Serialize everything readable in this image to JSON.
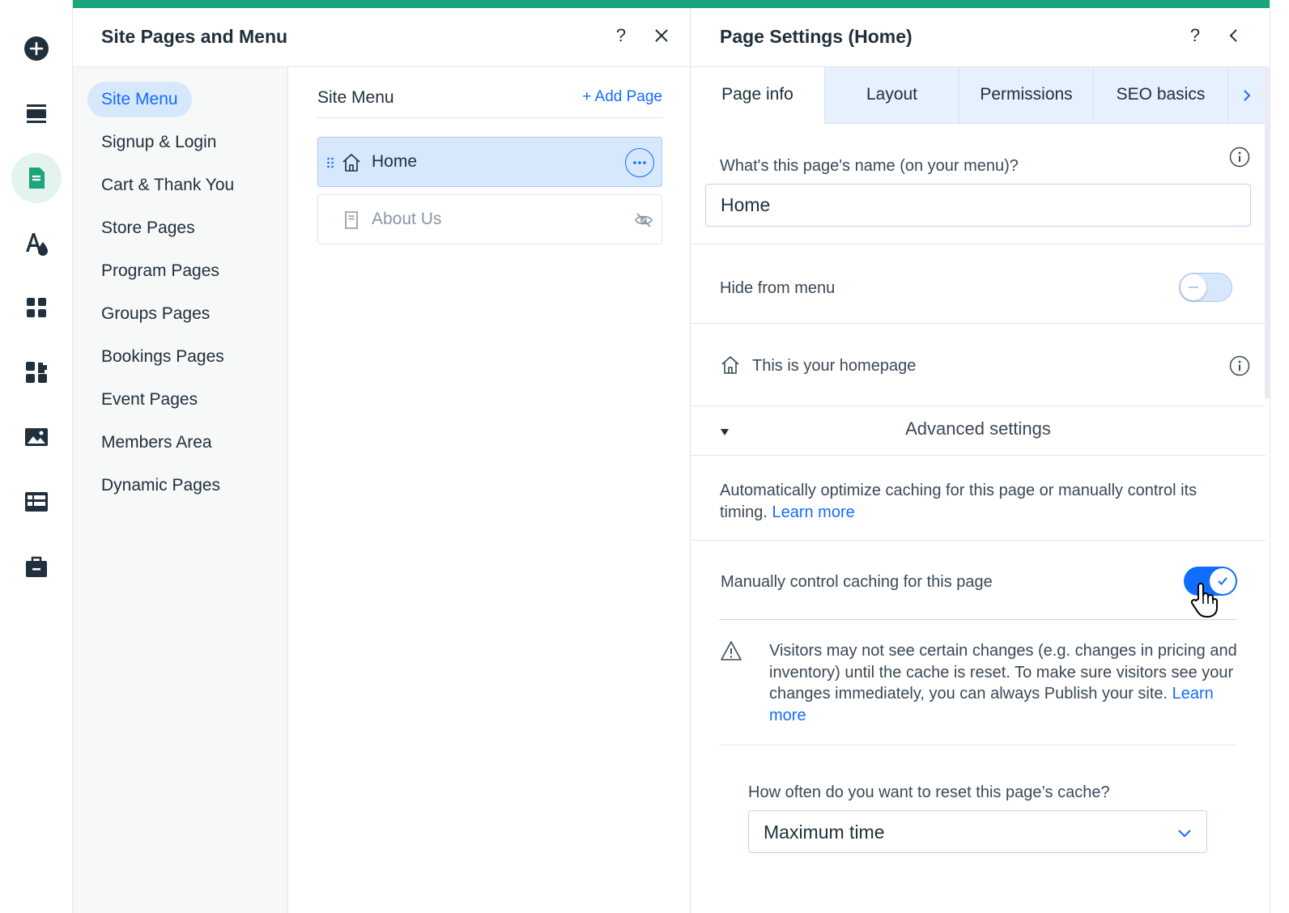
{
  "colors": {
    "accent": "#116dff",
    "brand_green": "#1ba57c",
    "selected_bg": "#d7e8fd"
  },
  "rail": {
    "items": [
      {
        "icon": "plus-circle-icon"
      },
      {
        "icon": "sections-icon"
      },
      {
        "icon": "pages-icon",
        "active": true
      },
      {
        "icon": "design-icon"
      },
      {
        "icon": "apps-icon"
      },
      {
        "icon": "business-apps-icon"
      },
      {
        "icon": "media-icon"
      },
      {
        "icon": "cms-table-icon"
      },
      {
        "icon": "portfolio-icon"
      }
    ]
  },
  "pages_panel": {
    "title": "Site Pages and Menu",
    "help_label": "?",
    "categories": [
      "Site Menu",
      "Signup & Login",
      "Cart & Thank You",
      "Store Pages",
      "Program Pages",
      "Groups Pages",
      "Bookings Pages",
      "Event Pages",
      "Members Area",
      "Dynamic Pages"
    ],
    "menu": {
      "title": "Site Menu",
      "add_page": "+ Add Page",
      "pages": [
        {
          "label": "Home",
          "icon": "home-icon",
          "selected": true
        },
        {
          "label": "About Us",
          "icon": "page-icon",
          "hidden": true
        }
      ]
    }
  },
  "settings": {
    "title": "Page Settings (Home)",
    "help_label": "?",
    "tabs": [
      "Page info",
      "Layout",
      "Permissions",
      "SEO basics"
    ],
    "name_label": "What's this page's name (on your menu)?",
    "name_value": "Home",
    "hide_from_menu": {
      "label": "Hide from menu",
      "on": false
    },
    "homepage_label": "This is your homepage",
    "advanced_label": "Advanced settings",
    "caching_text": "Automatically optimize caching for this page or manually control its timing.",
    "learn_more": "Learn more",
    "manual_caching": {
      "label": "Manually control caching for this page",
      "on": true
    },
    "warning_text": "Visitors may not see certain changes (e.g. changes in pricing and inventory) until the cache is reset. To make sure visitors see your changes immediately, you can always Publish your site.",
    "reset_question": "How often do you want to reset this page’s cache?",
    "reset_value": "Maximum time"
  }
}
